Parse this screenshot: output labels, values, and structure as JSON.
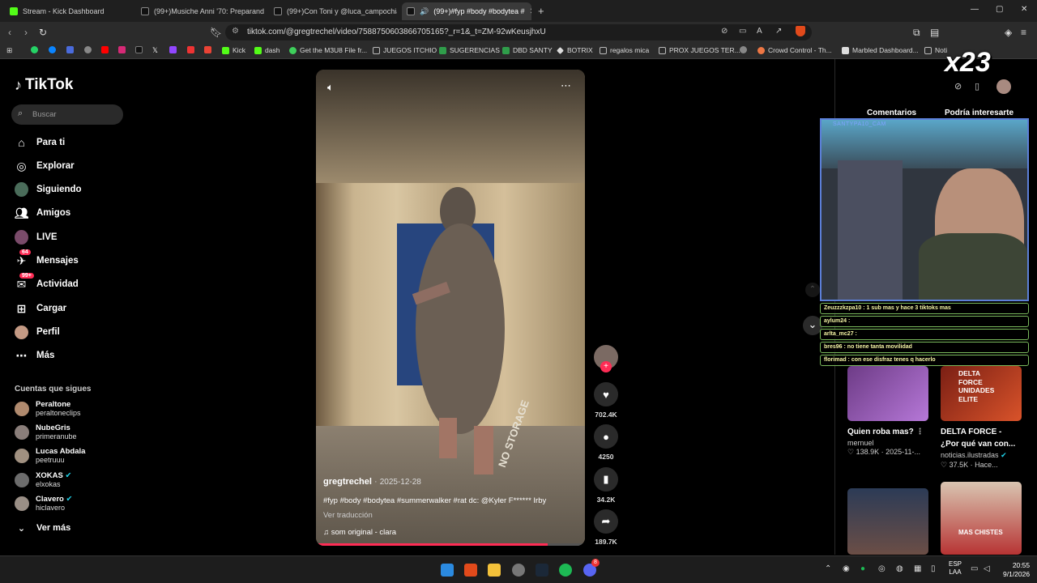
{
  "browser": {
    "tabs": [
      {
        "label": "Stream - Kick Dashboard",
        "active": false
      },
      {
        "label": "(99+)Musiche Anni '70: Preparandos",
        "active": false
      },
      {
        "label": "(99+)Con Toni y @luca_campochiaro",
        "active": false
      },
      {
        "label": "(99+)#fyp #body #bodytea #",
        "active": true
      }
    ],
    "url": "tiktok.com/@gregtrechel/video/7588750603866705165?_r=1&_t=ZM-92wKeusjhxU",
    "bookmarks": [
      "Kick",
      "dash",
      "Get the M3U8 File fr...",
      "JUEGOS ITCHIO",
      "SUGERENCIAS",
      "DBD SANTY",
      "BOTRIX",
      "regalos mica",
      "PROX JUEGOS TER...",
      "Crowd Control - Th...",
      "Marbled Dashboard...",
      "Noti"
    ]
  },
  "tiktok": {
    "logo": "TikTok",
    "search_placeholder": "Buscar",
    "nav": [
      {
        "label": "Para ti",
        "icon": "home-icon"
      },
      {
        "label": "Explorar",
        "icon": "compass-icon"
      },
      {
        "label": "Siguiendo",
        "icon": "following-avatar-icon"
      },
      {
        "label": "Amigos",
        "icon": "friends-icon"
      },
      {
        "label": "LIVE",
        "icon": "live-icon"
      },
      {
        "label": "Mensajes",
        "icon": "messages-icon",
        "badge": "64"
      },
      {
        "label": "Actividad",
        "icon": "activity-icon",
        "badge": "99+"
      },
      {
        "label": "Cargar",
        "icon": "upload-icon"
      },
      {
        "label": "Perfil",
        "icon": "profile-avatar-icon"
      },
      {
        "label": "Más",
        "icon": "more-icon"
      }
    ],
    "following_heading": "Cuentas que sigues",
    "following": [
      {
        "name": "Peraltone",
        "handle": "peraltoneclips",
        "verified": false
      },
      {
        "name": "NubeGris",
        "handle": "primeranube",
        "verified": false
      },
      {
        "name": "Lucas Abdala",
        "handle": "peetruuu",
        "verified": false
      },
      {
        "name": "XOKAS",
        "handle": "elxokas",
        "verified": true
      },
      {
        "name": "Clavero",
        "handle": "hiclavero",
        "verified": true
      }
    ],
    "see_more": "Ver más",
    "video": {
      "author": "gregtrechel",
      "date": "2025-12-28",
      "caption": "#fyp #body #bodytea #summerwalker #rat dc: @Kyler F****** Irby",
      "translate": "Ver traducción",
      "sound": "som original - clara",
      "floor_text": "NO STORAGE",
      "progress": 0.86
    },
    "actions": {
      "likes": "702.4K",
      "comments": "4250",
      "saves": "34.2K",
      "shares": "189.7K"
    },
    "right_tabs": [
      "Comentarios",
      "Podría interesarte"
    ],
    "suggested": [
      {
        "title": "Quien roba mas?",
        "author": "mernuel",
        "meta": "♡ 138.9K · 2025-11-...",
        "thumb_text": "",
        "verified": false
      },
      {
        "title": "DELTA FORCE - ¿Por qué van con...",
        "author": "noticias.ilustradas",
        "meta": "♡ 37.5K · Hace...",
        "thumb_text": "DELTA FORCE UNIDADES ELITE",
        "verified": true
      },
      {
        "title": "",
        "author": "",
        "meta": "",
        "thumb_text": "",
        "verified": false
      },
      {
        "title": "",
        "author": "",
        "meta": "",
        "thumb_text": "MAS CHISTES",
        "verified": false
      }
    ]
  },
  "overlay": {
    "cam_label": "SANTYPA10_CAM",
    "counter": "x23",
    "chat": [
      "Zeuzzzkzpa10 : 1 sub mas y hace 3 tiktoks mas",
      "aylum24 :",
      "arlta_mc27 :",
      "bres96 : no tiene tanta movilidad",
      "florimad : con ese disfraz tenes q hacerlo"
    ]
  },
  "taskbar": {
    "lang": "ESP",
    "lang2": "LAA",
    "time": "20:55",
    "date": "9/1/2026",
    "badge": "8"
  },
  "colors": {
    "accent": "#fe2c55",
    "cam_border": "#5c7fd8",
    "chat_border": "#7ab95c"
  }
}
